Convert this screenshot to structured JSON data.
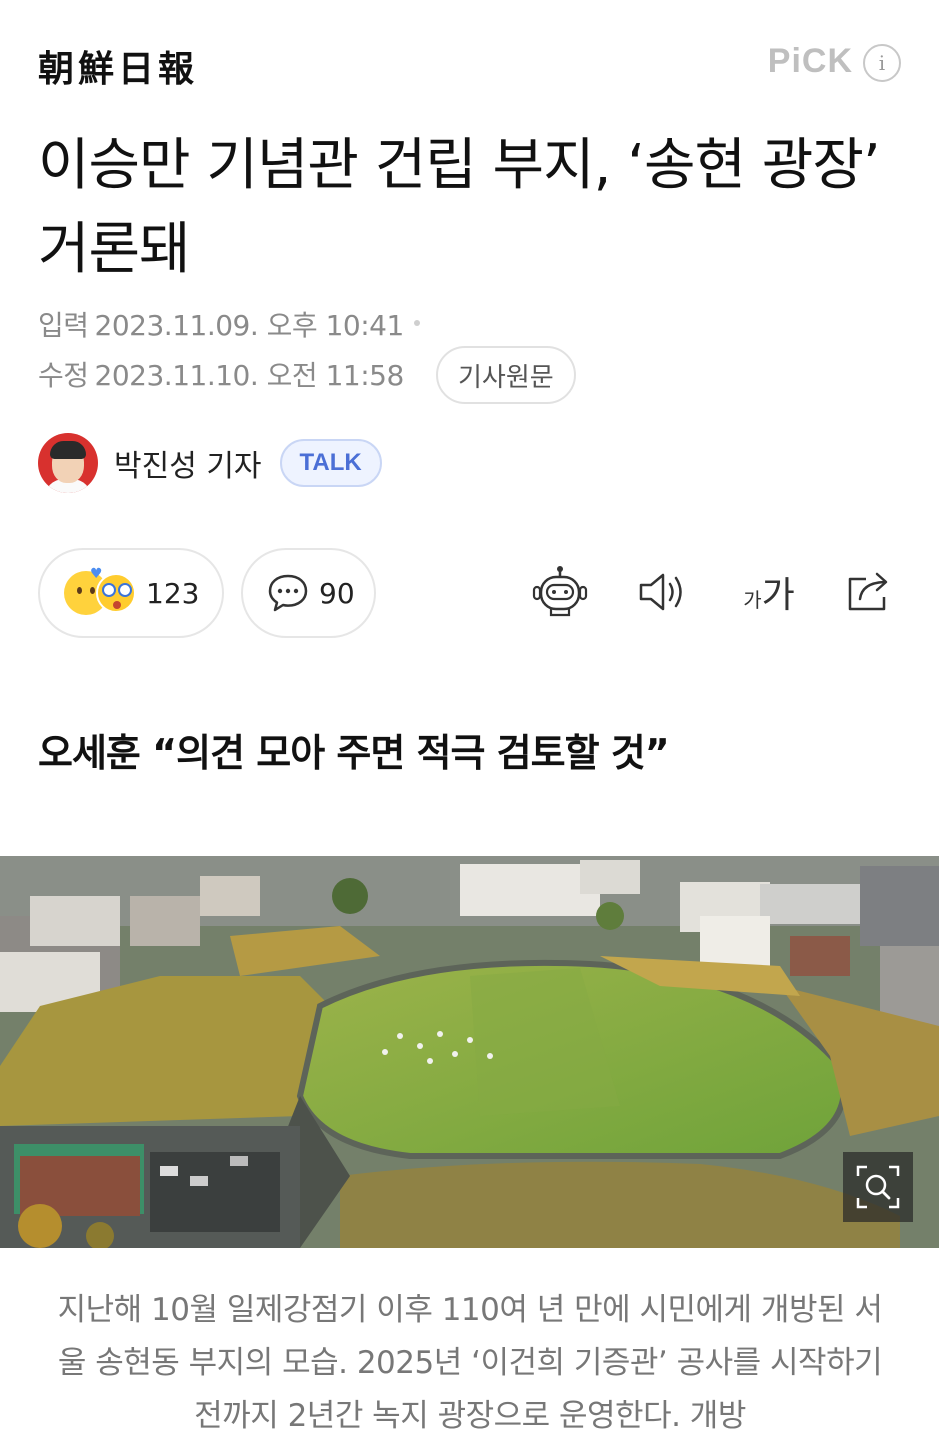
{
  "header": {
    "press_name": "朝鮮日報",
    "pick_label": "PiCK",
    "info_glyph": "i"
  },
  "article": {
    "title": "이승만 기념관 건립 부지, ‘송현 광장’ 거론돼",
    "published_label": "입력",
    "published_value": "2023.11.09. 오후 10:41",
    "modified_label": "수정",
    "modified_value": "2023.11.10. 오전 11:58",
    "origin_button": "기사원문",
    "author_name": "박진성 기자",
    "talk_button": "TALK",
    "subheadline": "오세훈 “의견 모아 주면 적극 검토할 것”",
    "photo_caption": "지난해 10월 일제강점기 이후 110여 년 만에 시민에게 개방된 서울 송현동 부지의 모습. 2025년 ‘이건희 기증관’ 공사를 시작하기 전까지 2년간 녹지 광장으로 운영한다. 개방"
  },
  "actions": {
    "reaction_count": "123",
    "comment_count": "90",
    "font_small": "가",
    "font_big": "가",
    "icons": [
      "emoji-reaction-icon",
      "comment-icon",
      "summary-robot-icon",
      "audio-speaker-icon",
      "font-size-icon",
      "share-icon",
      "zoom-search-icon"
    ]
  },
  "colors": {
    "talk_accent": "#4b6fd6",
    "avatar_bg": "#d8312e",
    "meta_text": "#8a8a8a"
  }
}
